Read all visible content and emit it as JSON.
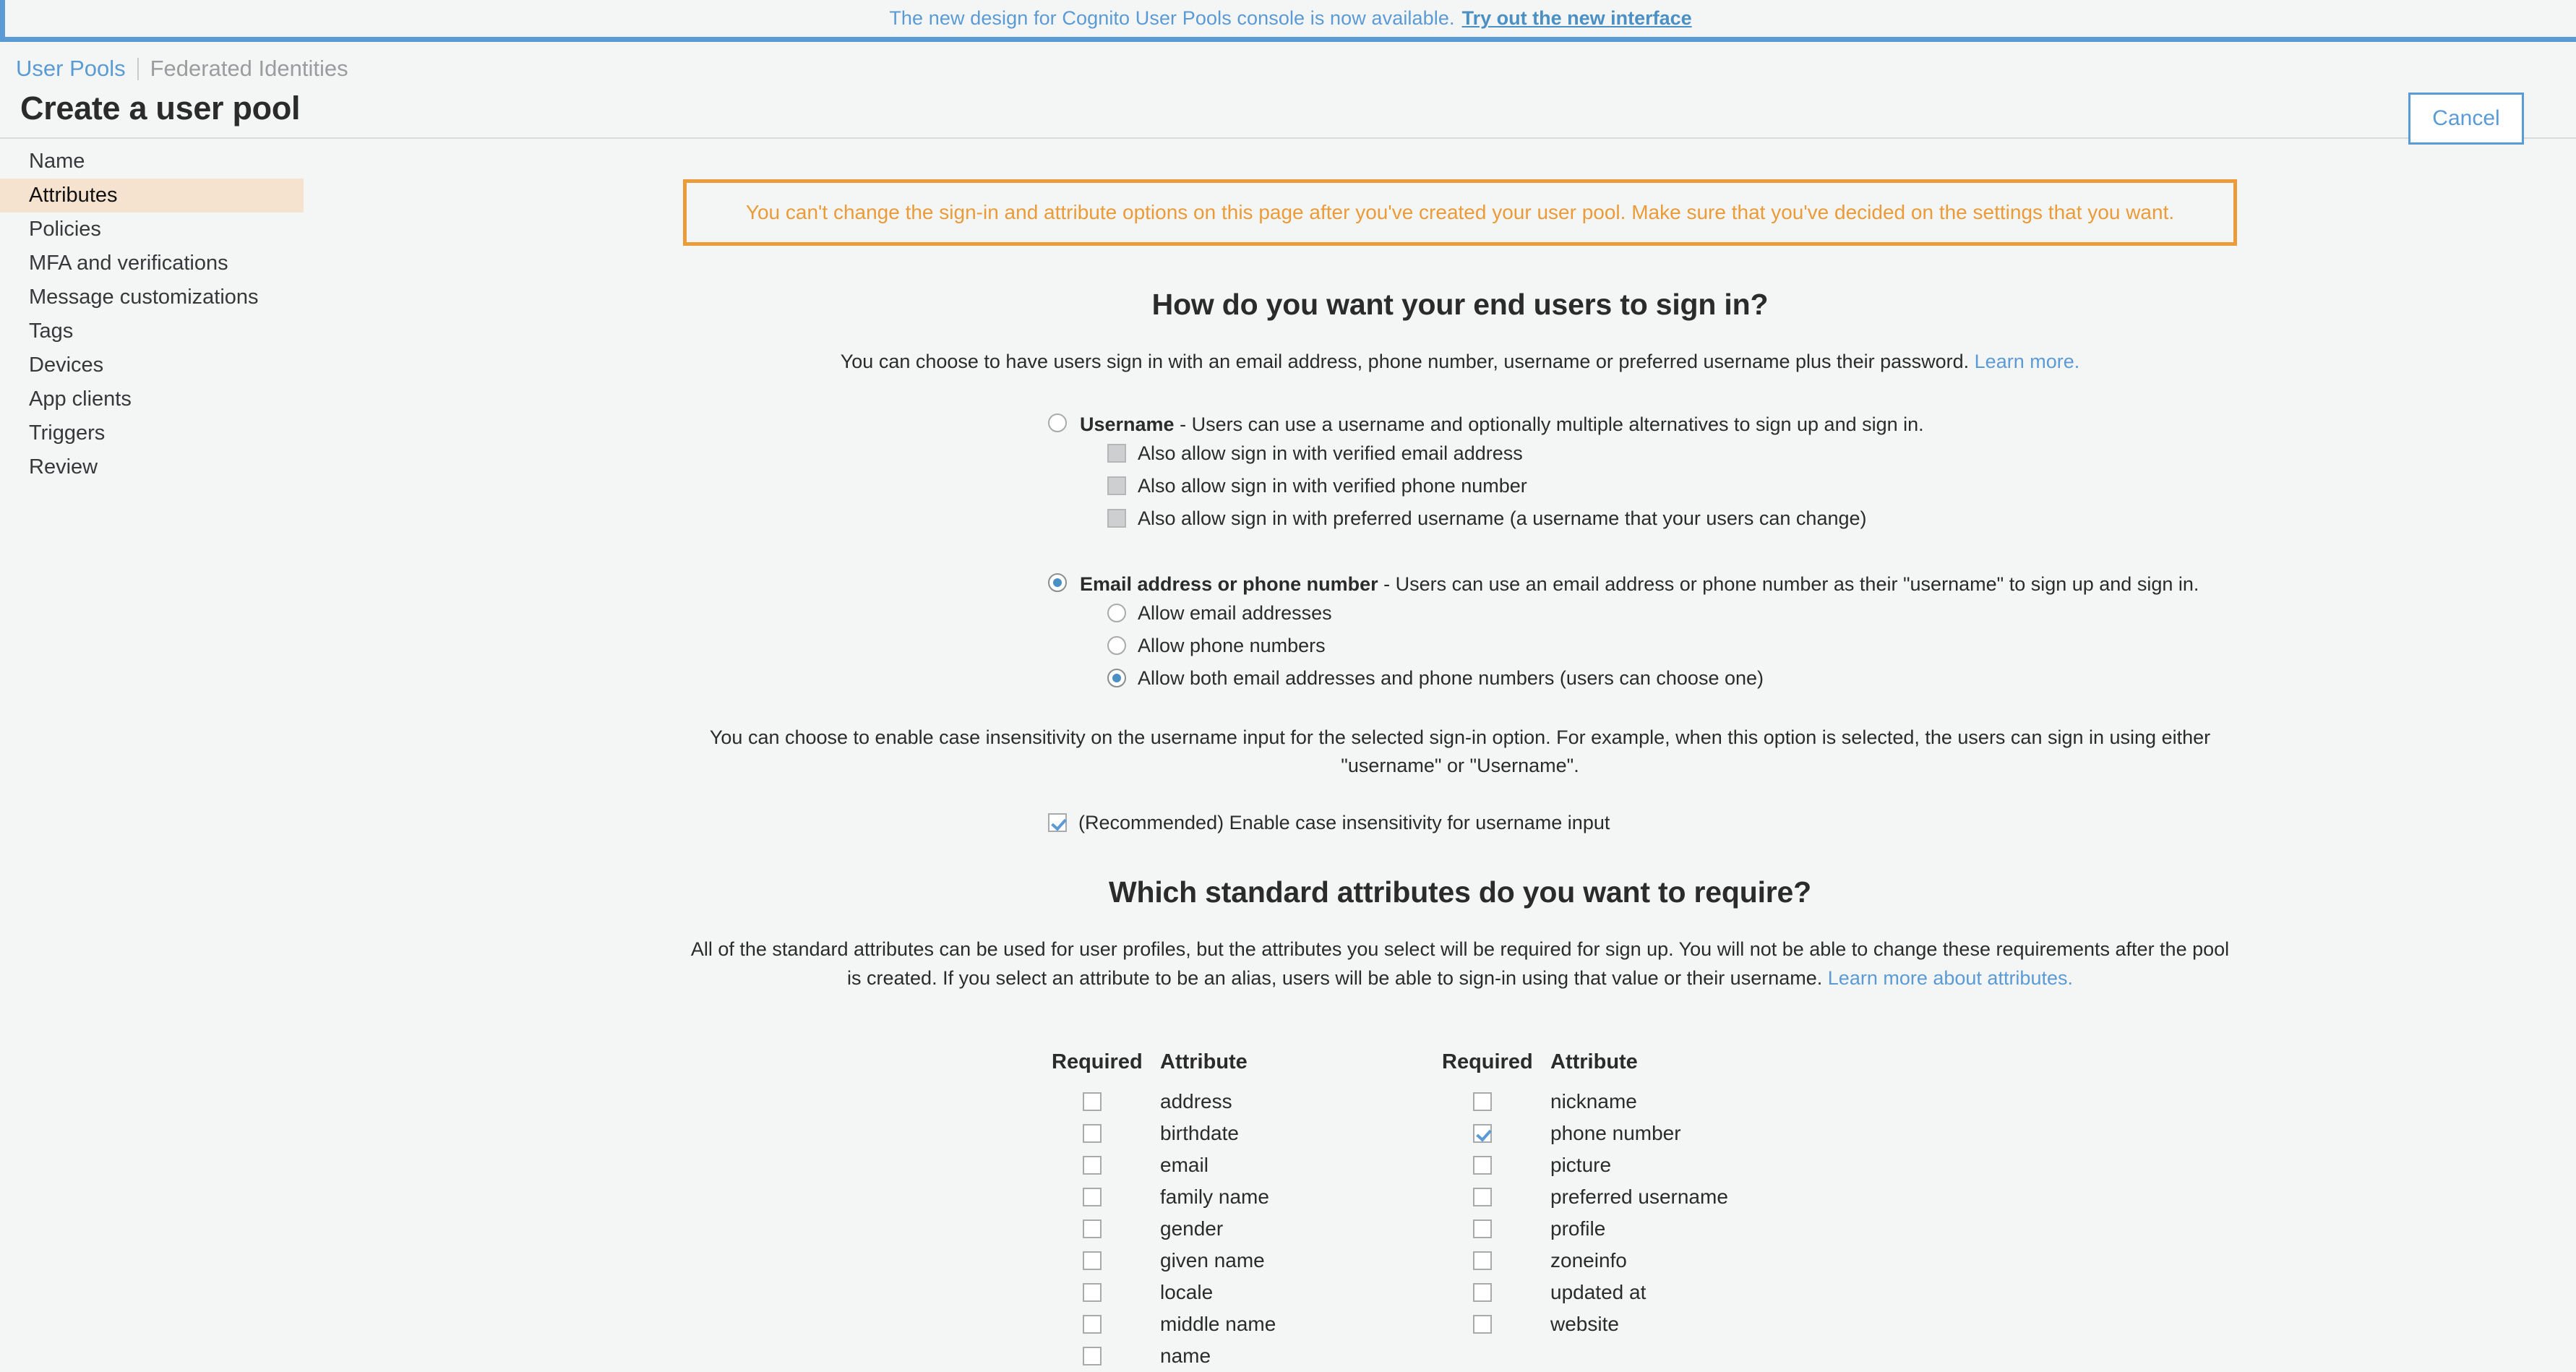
{
  "announcement": {
    "text": "The new design for Cognito User Pools console is now available.",
    "link_label": "Try out the new interface",
    "accent_color": "#5b9bd5"
  },
  "service_tabs": {
    "active": "User Pools",
    "inactive": "Federated Identities"
  },
  "header": {
    "title": "Create a user pool",
    "cancel_label": "Cancel"
  },
  "sidebar": {
    "selected": "Attributes",
    "highlight_color": "#f5e3d0",
    "items": [
      {
        "label": "Name"
      },
      {
        "label": "Attributes"
      },
      {
        "label": "Policies"
      },
      {
        "label": "MFA and verifications"
      },
      {
        "label": "Message customizations"
      },
      {
        "label": "Tags"
      },
      {
        "label": "Devices"
      },
      {
        "label": "App clients"
      },
      {
        "label": "Triggers"
      },
      {
        "label": "Review"
      }
    ]
  },
  "warning": {
    "text": "You can't change the sign-in and attribute options on this page after you've created your user pool. Make sure that you've decided on the settings that you want.",
    "color": "#eb9b38"
  },
  "signin_section": {
    "heading": "How do you want your end users to sign in?",
    "description": "You can choose to have users sign in with an email address, phone number, username or preferred username plus their password.",
    "learn_more": "Learn more.",
    "username_option": {
      "bold_label": "Username",
      "rest_label": " - Users can use a username and optionally multiple alternatives to sign up and sign in.",
      "selected": false,
      "sub_options": [
        {
          "label": "Also allow sign in with verified email address",
          "checked": false,
          "disabled": true
        },
        {
          "label": "Also allow sign in with verified phone number",
          "checked": false,
          "disabled": true
        },
        {
          "label": "Also allow sign in with preferred username (a username that your users can change)",
          "checked": false,
          "disabled": true
        }
      ]
    },
    "email_phone_option": {
      "bold_label": "Email address or phone number",
      "rest_label": " - Users can use an email address or phone number as their \"username\" to sign up and sign in.",
      "selected": true,
      "sub_options": [
        {
          "label": "Allow email addresses",
          "selected": false
        },
        {
          "label": "Allow phone numbers",
          "selected": false
        },
        {
          "label": "Allow both email addresses and phone numbers (users can choose one)",
          "selected": true
        }
      ]
    },
    "case_note": "You can choose to enable case insensitivity on the username input for the selected sign-in option. For example, when this option is selected, the users can sign in using either \"username\" or \"Username\".",
    "case_checkbox": {
      "label": "(Recommended) Enable case insensitivity for username input",
      "checked": true
    }
  },
  "attributes_section": {
    "heading": "Which standard attributes do you want to require?",
    "description": "All of the standard attributes can be used for user profiles, but the attributes you select will be required for sign up. You will not be able to change these requirements after the pool is created. If you select an attribute to be an alias, users will be able to sign-in using that value or their username.",
    "learn_more": "Learn more about attributes.",
    "columns": {
      "required_header": "Required",
      "attribute_header": "Attribute"
    },
    "left_column": [
      {
        "name": "address",
        "required": false
      },
      {
        "name": "birthdate",
        "required": false
      },
      {
        "name": "email",
        "required": false
      },
      {
        "name": "family name",
        "required": false
      },
      {
        "name": "gender",
        "required": false
      },
      {
        "name": "given name",
        "required": false
      },
      {
        "name": "locale",
        "required": false
      },
      {
        "name": "middle name",
        "required": false
      },
      {
        "name": "name",
        "required": false
      }
    ],
    "right_column": [
      {
        "name": "nickname",
        "required": false
      },
      {
        "name": "phone number",
        "required": true
      },
      {
        "name": "picture",
        "required": false
      },
      {
        "name": "preferred username",
        "required": false
      },
      {
        "name": "profile",
        "required": false
      },
      {
        "name": "zoneinfo",
        "required": false
      },
      {
        "name": "updated at",
        "required": false
      },
      {
        "name": "website",
        "required": false
      }
    ]
  }
}
